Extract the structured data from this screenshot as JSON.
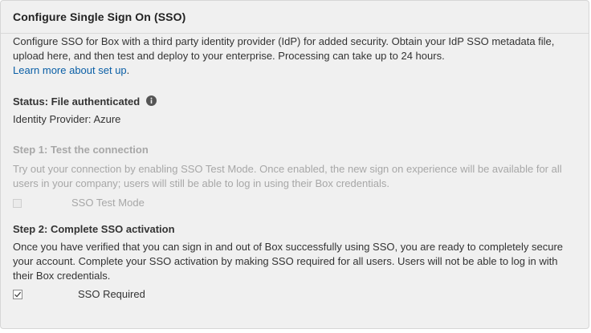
{
  "header": {
    "title": "Configure Single Sign On (SSO)"
  },
  "intro": {
    "line1": "Configure SSO for Box with a third party identity provider (IdP) for added security. Obtain your IdP SSO metadata file,",
    "line2": "upload here, and then test and deploy to your enterprise. Processing can take up to 24 hours.",
    "learn_more_link": "Learn more about set up",
    "learn_more_suffix": "."
  },
  "status": {
    "label": "Status: File authenticated",
    "info_icon": "info-icon",
    "identity_provider": "Identity Provider: Azure"
  },
  "step1": {
    "title": "Step 1: Test the connection",
    "desc_line1": "Try out your connection by enabling SSO Test Mode. Once enabled, the new sign on experience will be available for all",
    "desc_line2": "users in your company; users will still be able to log in using their Box credentials.",
    "checkbox_label": "SSO Test Mode",
    "checked": false,
    "enabled": false
  },
  "step2": {
    "title": "Step 2: Complete SSO activation",
    "desc_line1": "Once you have verified that you can sign in and out of Box successfully using SSO, you are ready to completely secure",
    "desc_line2": "your account. Complete your SSO activation by making SSO required for all users. Users will not be able to log in with",
    "desc_line3": "their Box credentials.",
    "checkbox_label": "SSO Required",
    "checked": true,
    "enabled": true
  },
  "colors": {
    "panel_bg": "#f0f0f0",
    "link": "#0a5fa6",
    "text": "#333333",
    "disabled_text": "#a7a7a7"
  }
}
